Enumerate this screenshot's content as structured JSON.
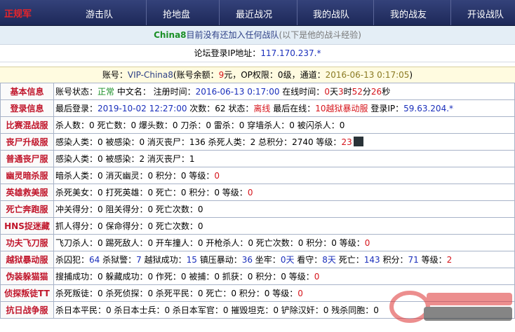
{
  "nav": {
    "logo": "正规军",
    "items": [
      "游击队",
      "抢地盘",
      "最近战况",
      "我的战队",
      "我的战友",
      "开设战队"
    ]
  },
  "notice": {
    "user": "China8",
    "text": "目前没有还加入任何战队",
    "note": "(以下是他的战斗经验)"
  },
  "ip_line": {
    "label": "论坛登录IP地址：",
    "ip": "117.170.237.*"
  },
  "account": {
    "label": "账号：",
    "id": "VIP-China8",
    "bal_label": "(账号余额：",
    "bal": "9",
    "bal_unit": "元",
    "op_label": "，OP权限：",
    "op": "0",
    "op_unit": "级",
    "ch_label": "，通道：",
    "ch": "2016-06-13 0:17:05",
    "close": ")"
  },
  "rows": {
    "basic": {
      "label": "基本信息",
      "status_label": "账号状态：",
      "status": "正常",
      "cn_label": " 中文名： 注册时间：",
      "reg": "2016-06-13 0:17:00",
      "ol_label": " 在线时间：",
      "d": "0",
      "d_u": "天",
      "h": "3",
      "h_u": "时",
      "m": "52",
      "m_u": "分",
      "s": "26",
      "s_u": "秒"
    },
    "login": {
      "label": "登录信息",
      "last_label": "最后登录：",
      "last": "2019-10-02 12:27:00",
      "cnt_label": " 次数：",
      "cnt": "62",
      "st_label": " 状态：",
      "st": "离线",
      "srv_label": " 最后在线：",
      "srv": "10越狱暴动服",
      "ip_label": " 登录IP：",
      "ip": "59.63.204.*"
    },
    "r1": {
      "label": "比赛混战服",
      "text": "杀人数：0 死亡数：0 爆头数：0 刀杀：0 雷杀：0 穿墙杀人：0 被闪杀人：0"
    },
    "r2": {
      "label": "丧尸升级服",
      "t1": "感染人类：0 被感染：0 消灭丧尸：136 杀死人类：2 总积分：2740 等级：",
      "lvl": "23"
    },
    "r3": {
      "label": "普通丧尸服",
      "text": "感染人类：0 被感染：2 消灭丧尸：1"
    },
    "r4": {
      "label": "幽灵暗杀服",
      "t1": "暗杀人类：0 消灭幽灵：0 积分：0 等级：",
      "lvl": "0"
    },
    "r5": {
      "label": "英雄救美服",
      "t1": "杀死美女：0 打死英雄：0 死亡：0 积分：0 等级：",
      "lvl": "0"
    },
    "r6": {
      "label": "死亡奔跑服",
      "text": "冲关得分：0 阻关得分：0 死亡次数：0"
    },
    "r7": {
      "label": "HNS捉迷藏",
      "text": "抓人得分：0 保命得分：0 死亡次数：0"
    },
    "r8": {
      "label": "功夫飞刀服",
      "t1": "飞刀杀人：0 踢死敌人：0 开车撞人：0 开枪杀人：0 死亡次数：0 积分：0 等级：",
      "lvl": "0"
    },
    "r9": {
      "label": "越狱暴动服",
      "a": "杀囚犯：",
      "a_v": "64",
      "b": " 杀狱警：",
      "b_v": "7",
      "c": " 越狱成功：",
      "c_v": "15",
      "d": " 镇压暴动：",
      "d_v": "36",
      "e": " 坐牢：",
      "e_v": "0天",
      "f": " 看守：",
      "f_v": "8天",
      "g": " 死亡：",
      "g_v": "143",
      "h": " 积分：",
      "h_v": "71",
      "i": " 等级：",
      "lvl": "2"
    },
    "r10": {
      "label": "伪装躲猫猫",
      "t1": "搜捕成功：0 躲藏成功：0 作死：0 被捕：0 抓获：0 积分：0 等级：",
      "lvl": "0"
    },
    "r11": {
      "label": "侦探叛徒TT",
      "t1": "杀死叛徒：0 杀死侦探：0 杀死平民：0 死亡：0 积分：0 等级：",
      "lvl": "0"
    },
    "r12": {
      "label": "抗日战争服",
      "text": "杀日本平民：0 杀日本士兵：0 杀日本军官：0 摧毁坦克：0 铲除汉奸：0 残杀同胞：0"
    }
  },
  "colors": {
    "nav_bg": "#1d2858",
    "label_red": "#c0152a",
    "green": "#1a8f26",
    "red": "#d6151c"
  }
}
